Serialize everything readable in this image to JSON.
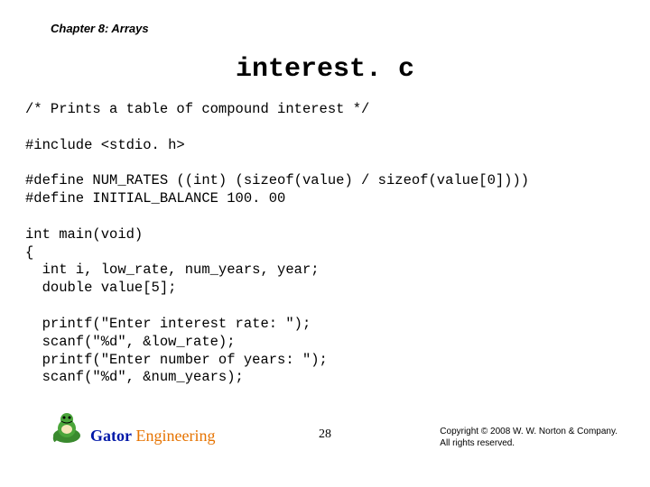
{
  "header": {
    "chapter": "Chapter 8: Arrays"
  },
  "title": "interest. c",
  "code": "/* Prints a table of compound interest */\n\n#include <stdio. h>\n\n#define NUM_RATES ((int) (sizeof(value) / sizeof(value[0])))\n#define INITIAL_BALANCE 100. 00\n\nint main(void)\n{\n  int i, low_rate, num_years, year;\n  double value[5];\n\n  printf(\"Enter interest rate: \");\n  scanf(\"%d\", &low_rate);\n  printf(\"Enter number of years: \");\n  scanf(\"%d\", &num_years);",
  "footer": {
    "brand_word1": "Gator",
    "brand_word2": " Engineering",
    "page_number": "28",
    "copyright_line1": "Copyright © 2008 W. W. Norton & Company.",
    "copyright_line2": "All rights reserved."
  }
}
